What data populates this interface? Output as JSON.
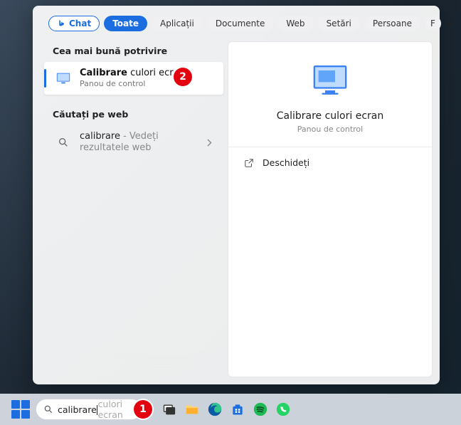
{
  "tabs": {
    "chat": "Chat",
    "items": [
      "Toate",
      "Aplicații",
      "Documente",
      "Web",
      "Setări",
      "Persoane",
      "F"
    ],
    "activeIndex": 0
  },
  "left": {
    "bestMatchHeader": "Cea mai bună potrivire",
    "result": {
      "title_bold": "Calibrare",
      "title_rest": " culori ecran",
      "subtitle": "Panou de control"
    },
    "webHeader": "Căutați pe web",
    "webItem": {
      "term": "calibrare",
      "suffix": " - Vedeți rezultatele web"
    }
  },
  "preview": {
    "title": "Calibrare culori ecran",
    "subtitle": "Panou de control",
    "open_label": "Deschideți"
  },
  "taskbar": {
    "search_typed": "calibrare",
    "search_placeholder": "culori ecran"
  },
  "annotations": {
    "step1": "1",
    "step2": "2"
  },
  "icons": {
    "task_view": "task-view-icon",
    "explorer": "file-explorer-icon",
    "edge": "edge-icon",
    "store": "microsoft-store-icon",
    "spotify": "spotify-icon",
    "whatsapp": "whatsapp-icon"
  }
}
